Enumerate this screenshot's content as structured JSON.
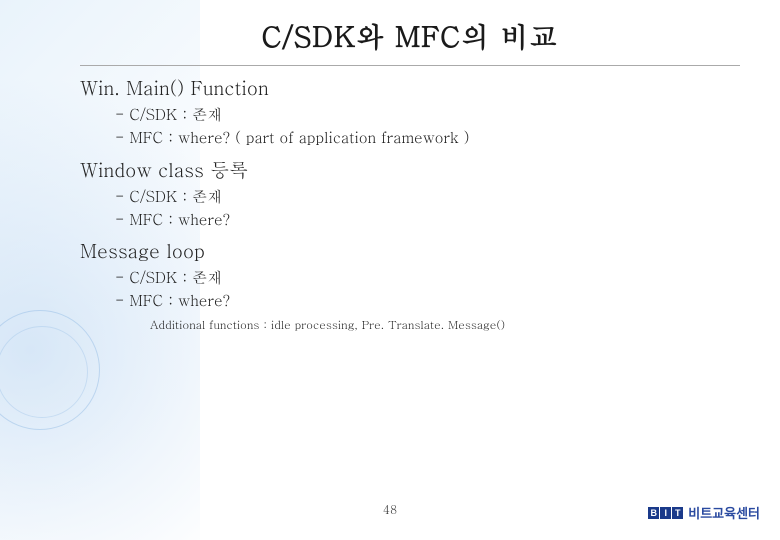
{
  "title": "C/SDK와 MFC의 비교",
  "sections": [
    {
      "heading": "Win. Main() Function",
      "items": [
        "- C/SDK : 존재",
        "- MFC : where? ( part of application framework )"
      ]
    },
    {
      "heading": "Window class 등록",
      "items": [
        "- C/SDK : 존재",
        "- MFC : where?"
      ]
    },
    {
      "heading": "Message loop",
      "items": [
        "- C/SDK : 존재",
        "- MFC : where?"
      ]
    }
  ],
  "additional_note": "Additional functions : idle processing, Pre. Translate. Message()",
  "page_number": "48",
  "brand": {
    "logo_chars": [
      "B",
      "I",
      "T"
    ],
    "text": "비트교육센터"
  }
}
